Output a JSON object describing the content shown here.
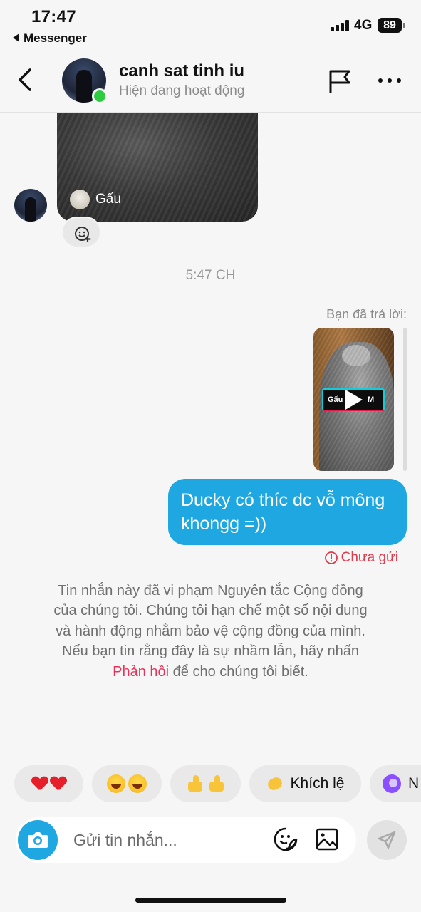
{
  "status_bar": {
    "time": "17:47",
    "back_app": "Messenger",
    "network": "4G",
    "battery": "89"
  },
  "header": {
    "name": "canh sat tinh iu",
    "status": "Hiện đang hoạt động",
    "icons": [
      "back-arrow-icon",
      "flag-icon",
      "more-icon"
    ]
  },
  "messages": {
    "story_label": "Gấu",
    "timestamp": "5:47 CH",
    "replied_label": "Bạn đã trả lời:",
    "video_tag_text": "Gấu",
    "video_tag_suffix": "M",
    "outgoing_text": "Ducky có thíc dc vỗ mông khongg =))",
    "unsent_label": "Chưa gửi",
    "violation_text": "Tin nhắn này đã vi phạm Nguyên tắc Cộng đồng của chúng tôi. Chúng tôi hạn chế một số nội dung và hành động nhằm bảo vệ cộng đồng của mình. Nếu bạn tin rằng đây là sự nhầm lẫn, hãy nhấn ",
    "violation_link": "Phản hồi",
    "violation_end": " để cho chúng tôi biết."
  },
  "quick_replies": {
    "encourage": "Khích lệ",
    "last_partial": "N"
  },
  "composer": {
    "placeholder": "Gửi tin nhắn..."
  },
  "colors": {
    "accent": "#1ea7e1",
    "error": "#e03a4b",
    "link": "#e8315a",
    "online": "#2ecc40"
  }
}
